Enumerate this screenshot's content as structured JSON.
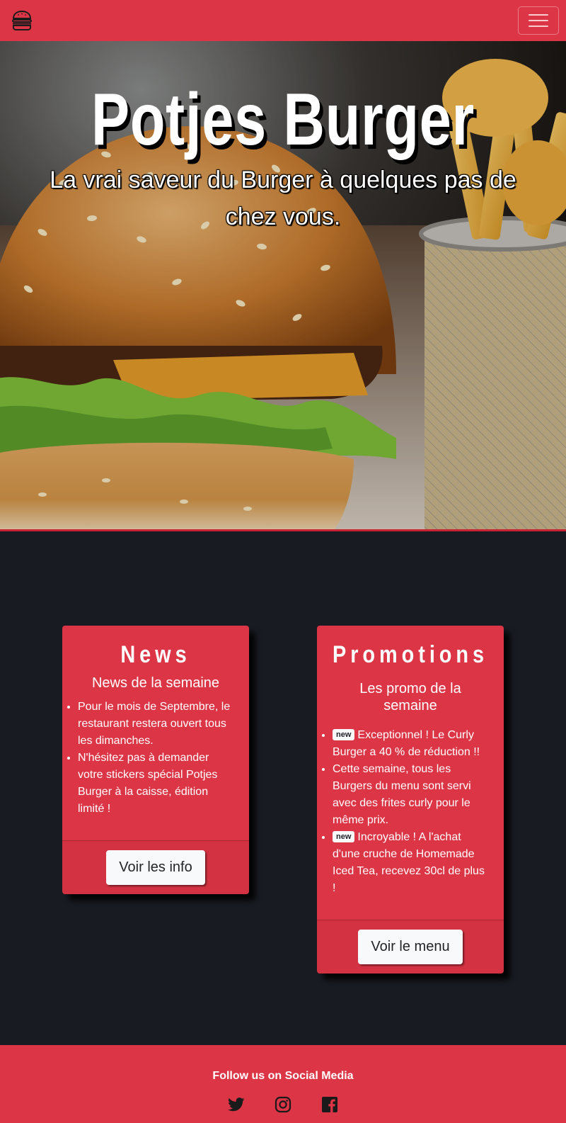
{
  "navbar": {
    "brand_icon": "burger-icon",
    "toggler_icon": "hamburger-menu-icon"
  },
  "hero": {
    "title": "Potjes Burger",
    "subtitle": "La vrai saveur du Burger à quelques pas de chez vous."
  },
  "news": {
    "title": "News",
    "subtitle": "News de la semaine",
    "items": [
      "Pour le mois de Septembre, le restaurant restera ouvert tous les dimanches.",
      "N'hésitez pas à demander votre stickers spécial Potjes Burger à la caisse, édition limité !"
    ],
    "button_label": "Voir les info"
  },
  "promotions": {
    "title": "Promotions",
    "subtitle": "Les promo de la semaine",
    "items": [
      {
        "badge": "new",
        "text": "Exceptionnel ! Le Curly Burger a 40 % de réduction !!"
      },
      {
        "badge": "",
        "text": "Cette semaine, tous les Burgers du menu sont servi avec des frites curly pour le même prix."
      },
      {
        "badge": "new",
        "text": "Incroyable ! A l'achat d'une cruche de Homemade Iced Tea, recevez 30cl de plus !"
      }
    ],
    "button_label": "Voir le menu"
  },
  "footer": {
    "title": "Follow us on Social Media",
    "icons": [
      "twitter-icon",
      "instagram-icon",
      "facebook-icon"
    ]
  },
  "colors": {
    "primary": "#dc3545",
    "dark": "#181b22",
    "light": "#f8f9fa"
  }
}
